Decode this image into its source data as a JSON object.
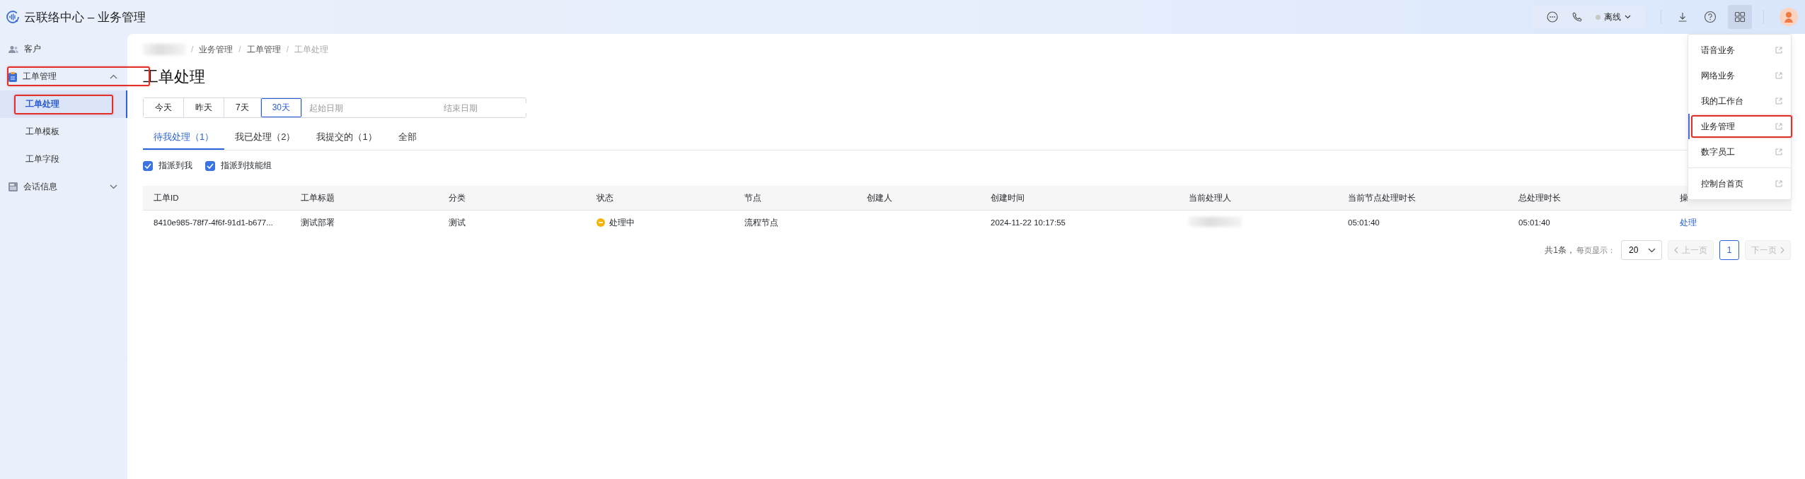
{
  "header": {
    "title": "云联络中心 – 业务管理",
    "status": "离线"
  },
  "sidebar": {
    "items": [
      {
        "label": "客户",
        "selected": false,
        "highlighted": false
      },
      {
        "label": "工单管理",
        "expanded": true,
        "selected": false,
        "highlighted": true,
        "children": [
          {
            "label": "工单处理",
            "selected": true,
            "highlighted": true
          },
          {
            "label": "工单模板",
            "selected": false,
            "highlighted": false
          },
          {
            "label": "工单字段",
            "selected": false,
            "highlighted": false
          }
        ]
      },
      {
        "label": "会话信息",
        "expanded": false,
        "selected": false,
        "highlighted": false
      }
    ]
  },
  "breadcrumb": [
    {
      "separator": "/",
      "label": "业务管理",
      "current": false
    },
    {
      "separator": "/",
      "label": "工单管理",
      "current": false
    },
    {
      "separator": "/",
      "label": "工单处理",
      "current": true
    }
  ],
  "page_title": "工单处理",
  "date_filter": {
    "quick": [
      {
        "label": "今天",
        "selected": false
      },
      {
        "label": "昨天",
        "selected": false
      },
      {
        "label": "7天",
        "selected": false
      },
      {
        "label": "30天",
        "selected": true
      }
    ],
    "start_placeholder": "起始日期",
    "end_placeholder": "结束日期"
  },
  "tabs": [
    {
      "label": "待我处理（1）",
      "selected": true
    },
    {
      "label": "我已处理（2）",
      "selected": false
    },
    {
      "label": "我提交的（1）",
      "selected": false
    },
    {
      "label": "全部",
      "selected": false
    }
  ],
  "filters": [
    {
      "label": "指派到我",
      "checked": true
    },
    {
      "label": "指派到技能组",
      "checked": true
    }
  ],
  "table": {
    "columns": [
      "工单ID",
      "工单标题",
      "分类",
      "状态",
      "节点",
      "创建人",
      "创建时间",
      "当前处理人",
      "当前节点处理时长",
      "总处理时长",
      "操"
    ],
    "rows": [
      {
        "id": "8410e985-78f7-4f6f-91d1-b677...",
        "title": "测试部署",
        "category": "测试",
        "status": "处理中",
        "node": "流程节点",
        "created_at": "2024-11-22 10:17:55",
        "node_duration": "05:01:40",
        "total_duration": "05:01:40",
        "action": "处理"
      }
    ]
  },
  "pagination": {
    "total": "共1条，",
    "page_size_label": "每页显示：",
    "page_size": "20",
    "prev": "上一页",
    "next": "下一页",
    "prev_disabled": true,
    "next_disabled": true,
    "pages": [
      {
        "label": "1",
        "selected": true
      }
    ]
  },
  "app_menu": {
    "open": true,
    "groups": [
      [
        {
          "label": "语音业务",
          "selected": false,
          "highlighted": false
        },
        {
          "label": "网络业务",
          "selected": false,
          "highlighted": false
        },
        {
          "label": "我的工作台",
          "selected": false,
          "highlighted": false
        },
        {
          "label": "业务管理",
          "selected": true,
          "highlighted": true
        },
        {
          "label": "数字员工",
          "selected": false,
          "highlighted": false
        }
      ],
      [
        {
          "label": "控制台首页",
          "selected": false,
          "highlighted": false
        }
      ]
    ]
  }
}
